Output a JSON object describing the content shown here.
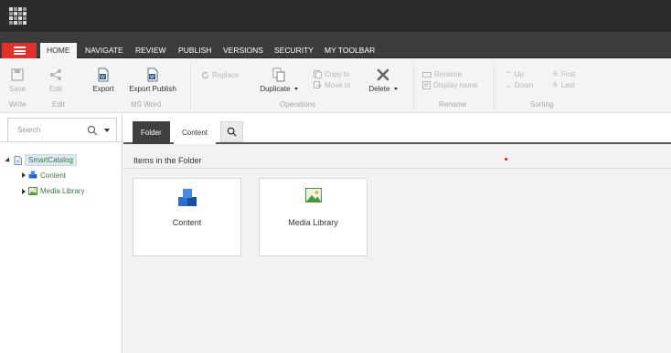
{
  "colors": {
    "topbar": "#2b2b2b",
    "tabbar": "#3c3c3c",
    "accent_red": "#e0312c",
    "ribbon_bg": "#f4f4f4",
    "tree_text": "#3b7a3b"
  },
  "tabs": [
    "HOME",
    "NAVIGATE",
    "REVIEW",
    "PUBLISH",
    "VERSIONS",
    "SECURITY",
    "MY TOOLBAR"
  ],
  "ribbon": {
    "save": "Save",
    "edit": "Edit",
    "export": "Export",
    "export_publish": "Export Publish",
    "replace": "Replace",
    "duplicate": "Duplicate",
    "copy_to": "Copy to",
    "move_to": "Move to",
    "delete": "Delete",
    "rename": "Rename",
    "display_name": "Display name",
    "up": "Up",
    "down": "Down",
    "first": "First",
    "last": "Last",
    "groups": {
      "write": "Write",
      "edit": "Edit",
      "ms_word": "MS Word",
      "operations": "Operations",
      "rename": "Rename",
      "sorting": "Sorting"
    }
  },
  "search": {
    "placeholder": "Search"
  },
  "tree": {
    "root": "SmartCatalog",
    "children": [
      "Content",
      "Media Library"
    ]
  },
  "main": {
    "tabs": [
      "Folder",
      "Content"
    ],
    "section_title": "Items in the Folder",
    "cards": [
      {
        "label": "Content",
        "icon": "cubes-icon"
      },
      {
        "label": "Media Library",
        "icon": "image-icon"
      }
    ]
  }
}
